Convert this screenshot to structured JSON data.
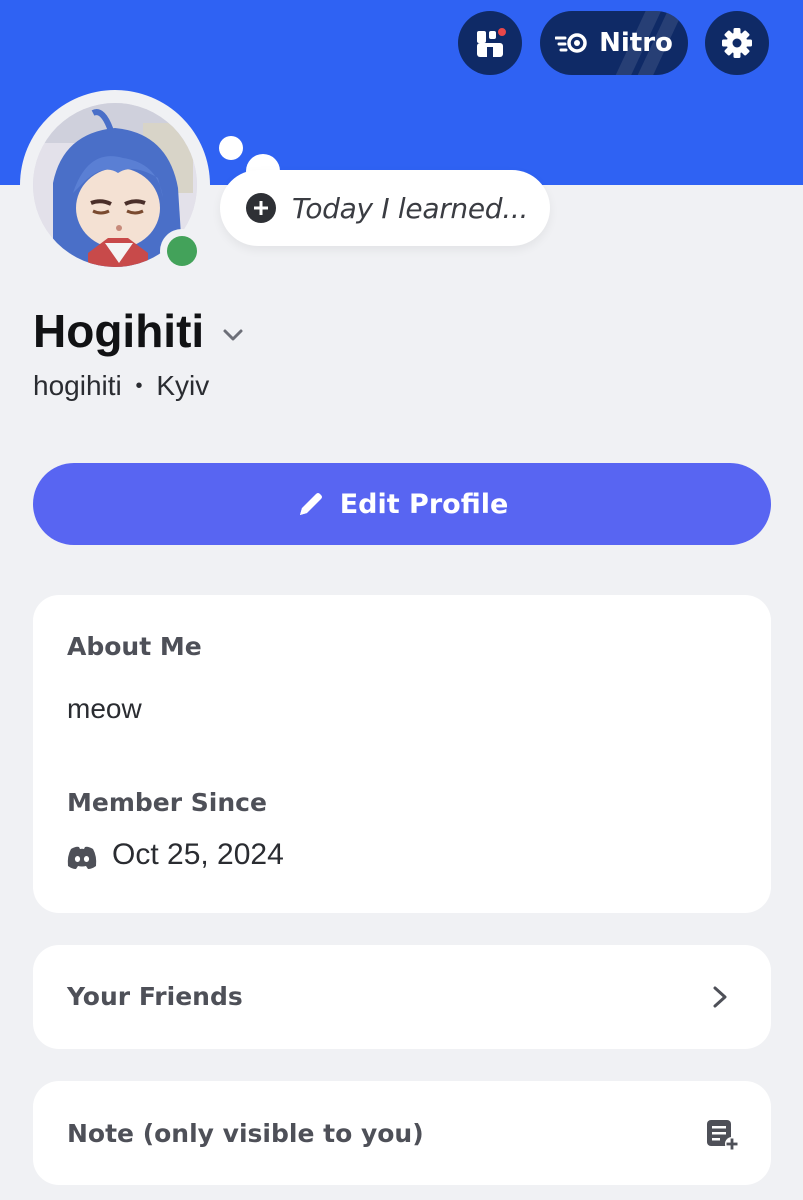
{
  "header": {
    "banner_color": "#2f62f3",
    "shop_icon": "shop-icon",
    "nitro_label": "Nitro",
    "nitro_icon": "nitro-icon",
    "settings_icon": "gear-icon"
  },
  "profile": {
    "display_name": "Hogihiti",
    "username": "hogihiti",
    "separator": "•",
    "location": "Kyiv",
    "status_placeholder": "Today I learned...",
    "online_status_color": "#43a25a"
  },
  "actions": {
    "edit_profile_label": "Edit Profile"
  },
  "about": {
    "heading": "About Me",
    "text": "meow",
    "member_since_heading": "Member Since",
    "member_since_date": "Oct 25, 2024"
  },
  "friends": {
    "label": "Your Friends"
  },
  "note": {
    "label": "Note (only visible to you)"
  },
  "colors": {
    "accent": "#5865f2",
    "page_background": "#f0f1f4",
    "card_background": "#ffffff",
    "top_button_background": "#0f2a66"
  }
}
